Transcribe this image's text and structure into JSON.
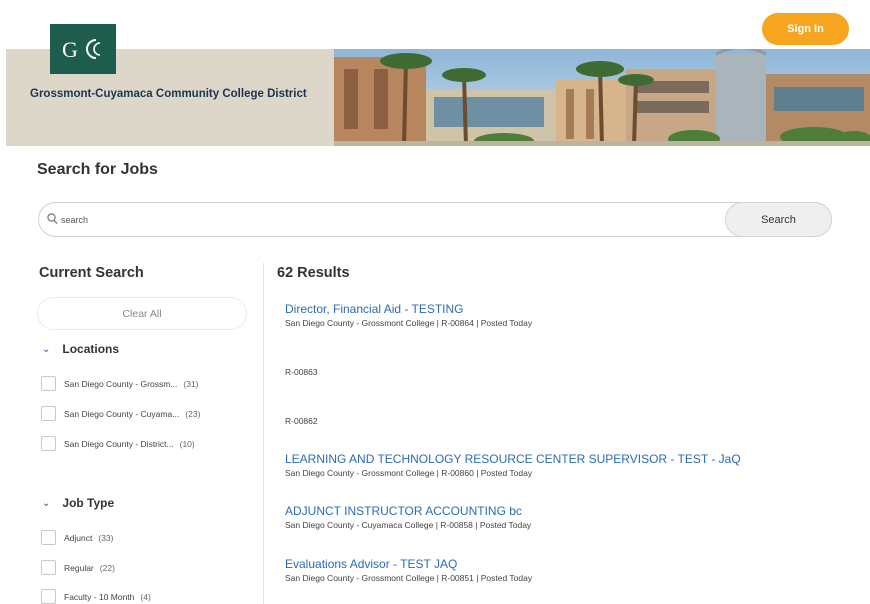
{
  "header": {
    "logo_alt": "G",
    "district_name": "Grossmont-Cuyamaca Community College District",
    "sign_in_label": "Sign In"
  },
  "search": {
    "title": "Search for Jobs",
    "placeholder": "search",
    "button_label": "Search"
  },
  "sidebar": {
    "title": "Current Search",
    "clear_all_label": "Clear All",
    "facets": [
      {
        "label": "Locations",
        "items": [
          {
            "label": "San Diego County - Grossm...",
            "count": "(31)"
          },
          {
            "label": "San Diego County - Cuyama...",
            "count": "(23)"
          },
          {
            "label": "San Diego County - District...",
            "count": "(10)"
          }
        ]
      },
      {
        "label": "Job Type",
        "items": [
          {
            "label": "Adjunct",
            "count": "(33)"
          },
          {
            "label": "Regular",
            "count": "(22)"
          },
          {
            "label": "Faculty - 10 Month",
            "count": "(4)"
          }
        ]
      }
    ]
  },
  "results": {
    "count_label": "62 Results",
    "jobs": [
      {
        "title": "Director, Financial Aid - TESTING",
        "meta": "San Diego County - Grossmont College  |  R-00864  |  Posted Today"
      },
      {
        "title": "",
        "meta": "R-00863"
      },
      {
        "title": "",
        "meta": "R-00862"
      },
      {
        "title": "LEARNING AND TECHNOLOGY RESOURCE CENTER SUPERVISOR - TEST - JaQ",
        "meta": "San Diego County - Grossmont College  |  R-00860  |  Posted Today"
      },
      {
        "title": "ADJUNCT INSTRUCTOR ACCOUNTING bc",
        "meta": "San Diego County - Cuyamaca College  |  R-00858  |  Posted Today"
      },
      {
        "title": "Evaluations Advisor - TEST JAQ",
        "meta": "San Diego County - Grossmont College  |  R-00851  |  Posted Today"
      }
    ]
  },
  "colors": {
    "brand_green": "#1e5c4e",
    "accent_orange": "#f7a51e",
    "link_blue": "#2b6cb5"
  }
}
